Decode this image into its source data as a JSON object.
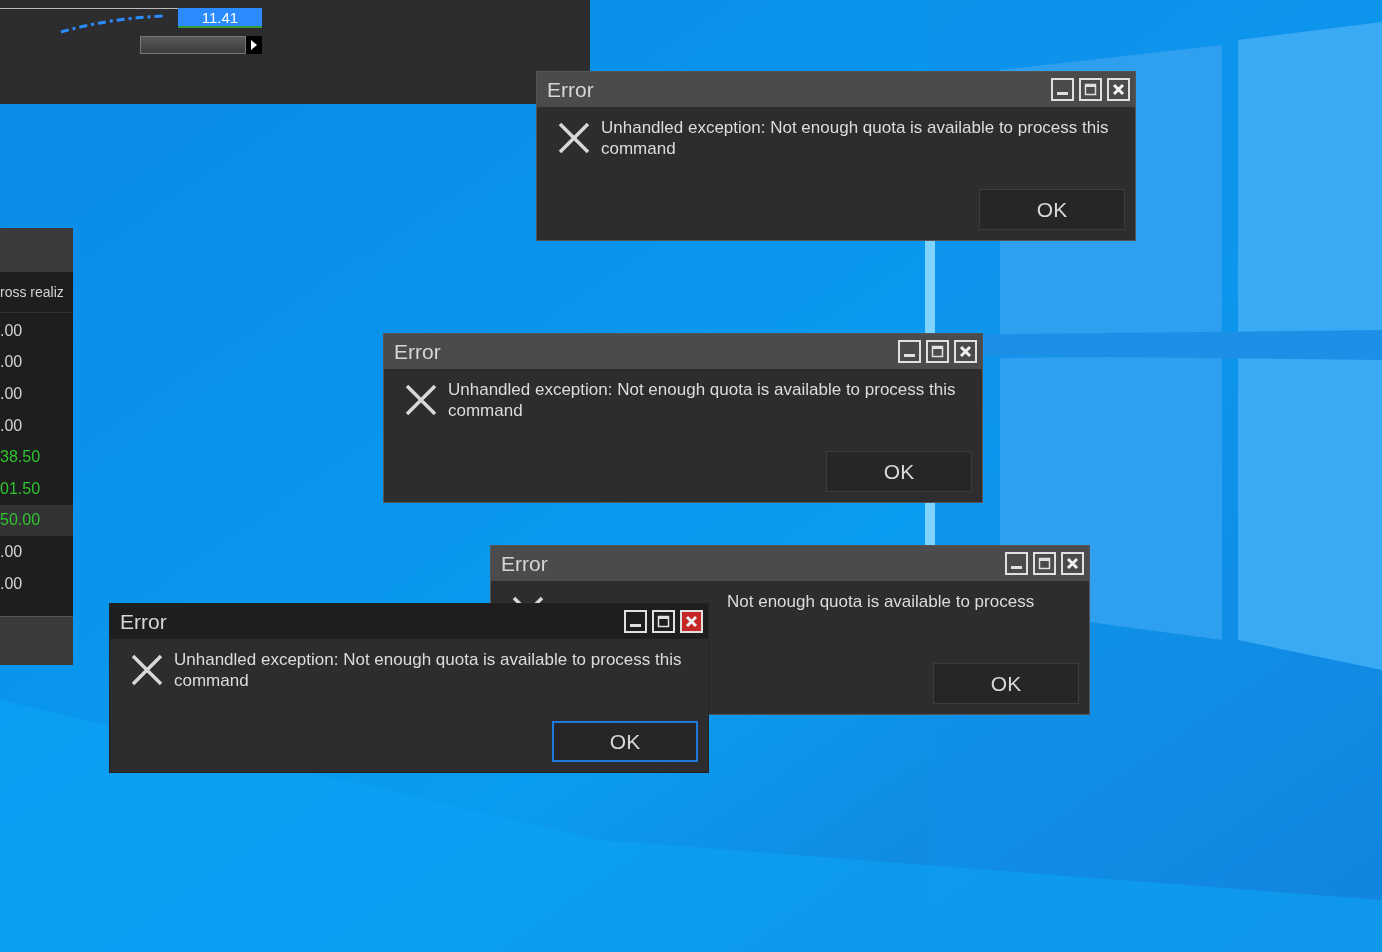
{
  "chart_window": {
    "price_label": "11.41"
  },
  "table_window": {
    "column_header": "ross realiz",
    "rows": [
      {
        "value": ".00",
        "color": "#d4d4d4",
        "selected": false
      },
      {
        "value": ".00",
        "color": "#d4d4d4",
        "selected": false
      },
      {
        "value": ".00",
        "color": "#d4d4d4",
        "selected": false
      },
      {
        "value": ".00",
        "color": "#d4d4d4",
        "selected": false
      },
      {
        "value": "38.50",
        "color": "#2ec42e",
        "selected": false
      },
      {
        "value": "01.50",
        "color": "#2ec42e",
        "selected": false
      },
      {
        "value": "50.00",
        "color": "#2ec42e",
        "selected": true
      },
      {
        "value": ".00",
        "color": "#d4d4d4",
        "selected": false
      },
      {
        "value": ".00",
        "color": "#d4d4d4",
        "selected": false
      }
    ]
  },
  "dialogs": [
    {
      "title": "Error",
      "message": "Unhandled exception: Not enough quota is available to process this command",
      "button": "OK",
      "active": false
    },
    {
      "title": "Error",
      "message": "Unhandled exception: Not enough quota is available to process this command",
      "button": "OK",
      "active": false
    },
    {
      "title": "Error",
      "message": "Not enough quota is available to process",
      "button": "OK",
      "active": false
    },
    {
      "title": "Error",
      "message": "Unhandled exception: Not enough quota is available to process this command",
      "button": "OK",
      "active": true
    }
  ]
}
